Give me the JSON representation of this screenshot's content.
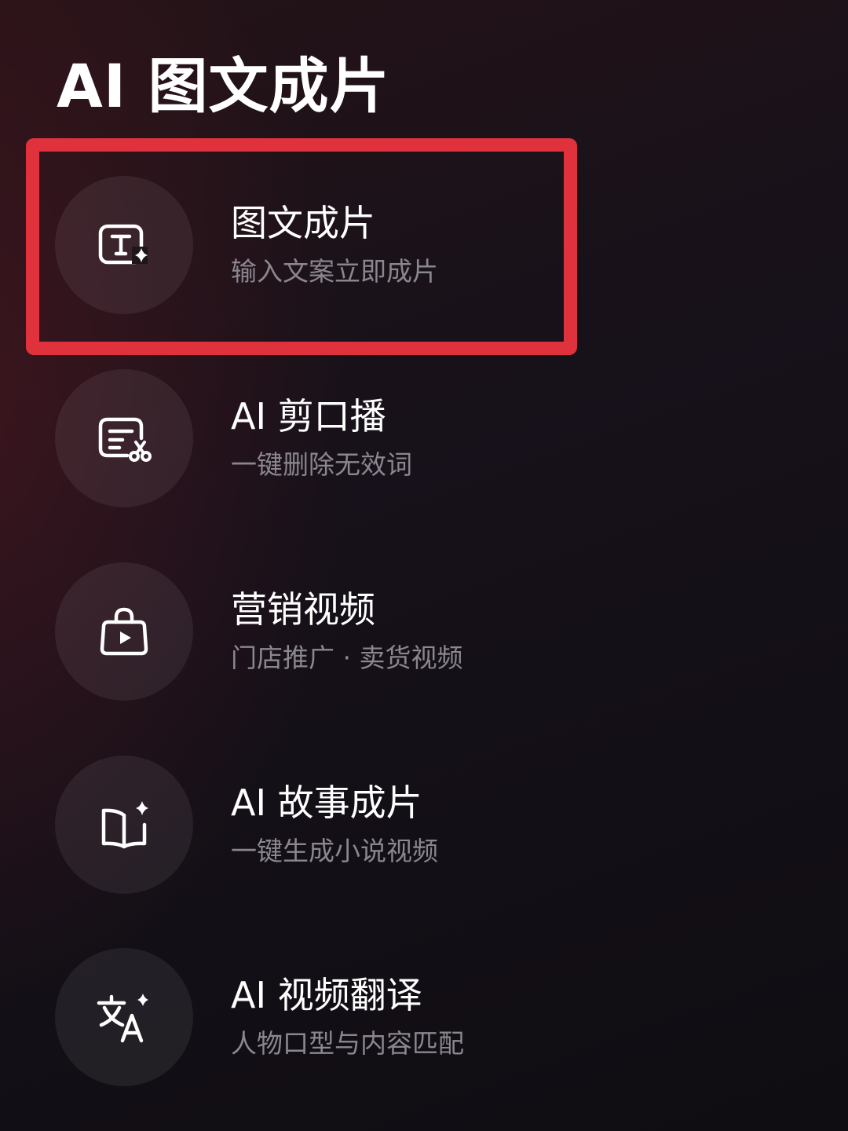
{
  "page": {
    "title": "AI 图文成片"
  },
  "menu": {
    "items": [
      {
        "label": "图文成片",
        "description": "输入文案立即成片",
        "icon": "text-sparkle-icon"
      },
      {
        "label": "AI 剪口播",
        "description": "一键删除无效词",
        "icon": "text-scissors-icon"
      },
      {
        "label": "营销视频",
        "description": "门店推广 · 卖货视频",
        "icon": "shopping-bag-play-icon"
      },
      {
        "label": "AI 故事成片",
        "description": "一键生成小说视频",
        "icon": "book-sparkle-icon"
      },
      {
        "label": "AI 视频翻译",
        "description": "人物口型与内容匹配",
        "icon": "translate-icon"
      }
    ]
  },
  "highlight": {
    "target": "图文成片",
    "color": "#e0323d"
  },
  "colors": {
    "text_primary": "#ffffff",
    "text_secondary": "#8a8790",
    "icon_circle": "rgba(255,255,255,0.07)"
  }
}
